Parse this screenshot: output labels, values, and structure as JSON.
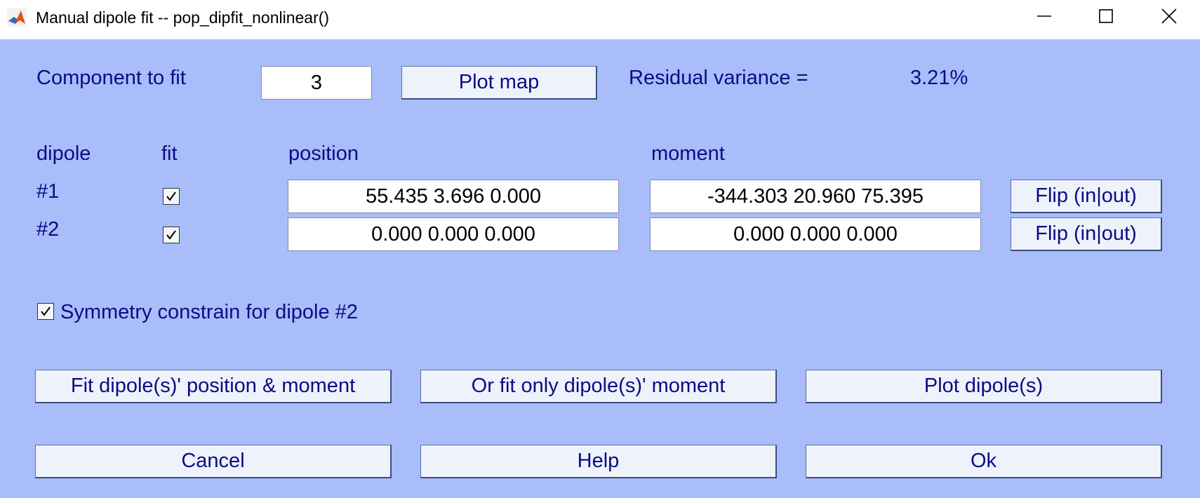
{
  "window": {
    "title": "Manual dipole fit -- pop_dipfit_nonlinear()",
    "icons": {
      "app": "matlab-icon",
      "minimize": "minimize-icon",
      "maximize": "maximize-icon",
      "close": "close-icon"
    }
  },
  "component": {
    "label": "Component to fit",
    "value": "3",
    "plot_map_label": "Plot map",
    "residual_label": "Residual variance =",
    "residual_value": "3.21%"
  },
  "dipole_table": {
    "headers": {
      "dipole": "dipole",
      "fit": "fit",
      "position": "position",
      "moment": "moment"
    },
    "rows": [
      {
        "id": "#1",
        "fit": true,
        "position": "55.435 3.696 0.000",
        "moment": "-344.303 20.960 75.395",
        "flip_label": "Flip (in|out)"
      },
      {
        "id": "#2",
        "fit": true,
        "position": "0.000 0.000 0.000",
        "moment": "0.000 0.000 0.000",
        "flip_label": "Flip (in|out)"
      }
    ]
  },
  "symmetry": {
    "checked": true,
    "label": "Symmetry constrain for dipole #2"
  },
  "actions": {
    "fit_position_moment": "Fit dipole(s)' position & moment",
    "fit_moment_only": "Or fit only dipole(s)' moment",
    "plot_dipoles": "Plot dipole(s)"
  },
  "footer": {
    "cancel": "Cancel",
    "help": "Help",
    "ok": "Ok"
  },
  "colors": {
    "background": "#a8bdfa",
    "text": "#0c0c84",
    "button": "#eef2fb"
  }
}
